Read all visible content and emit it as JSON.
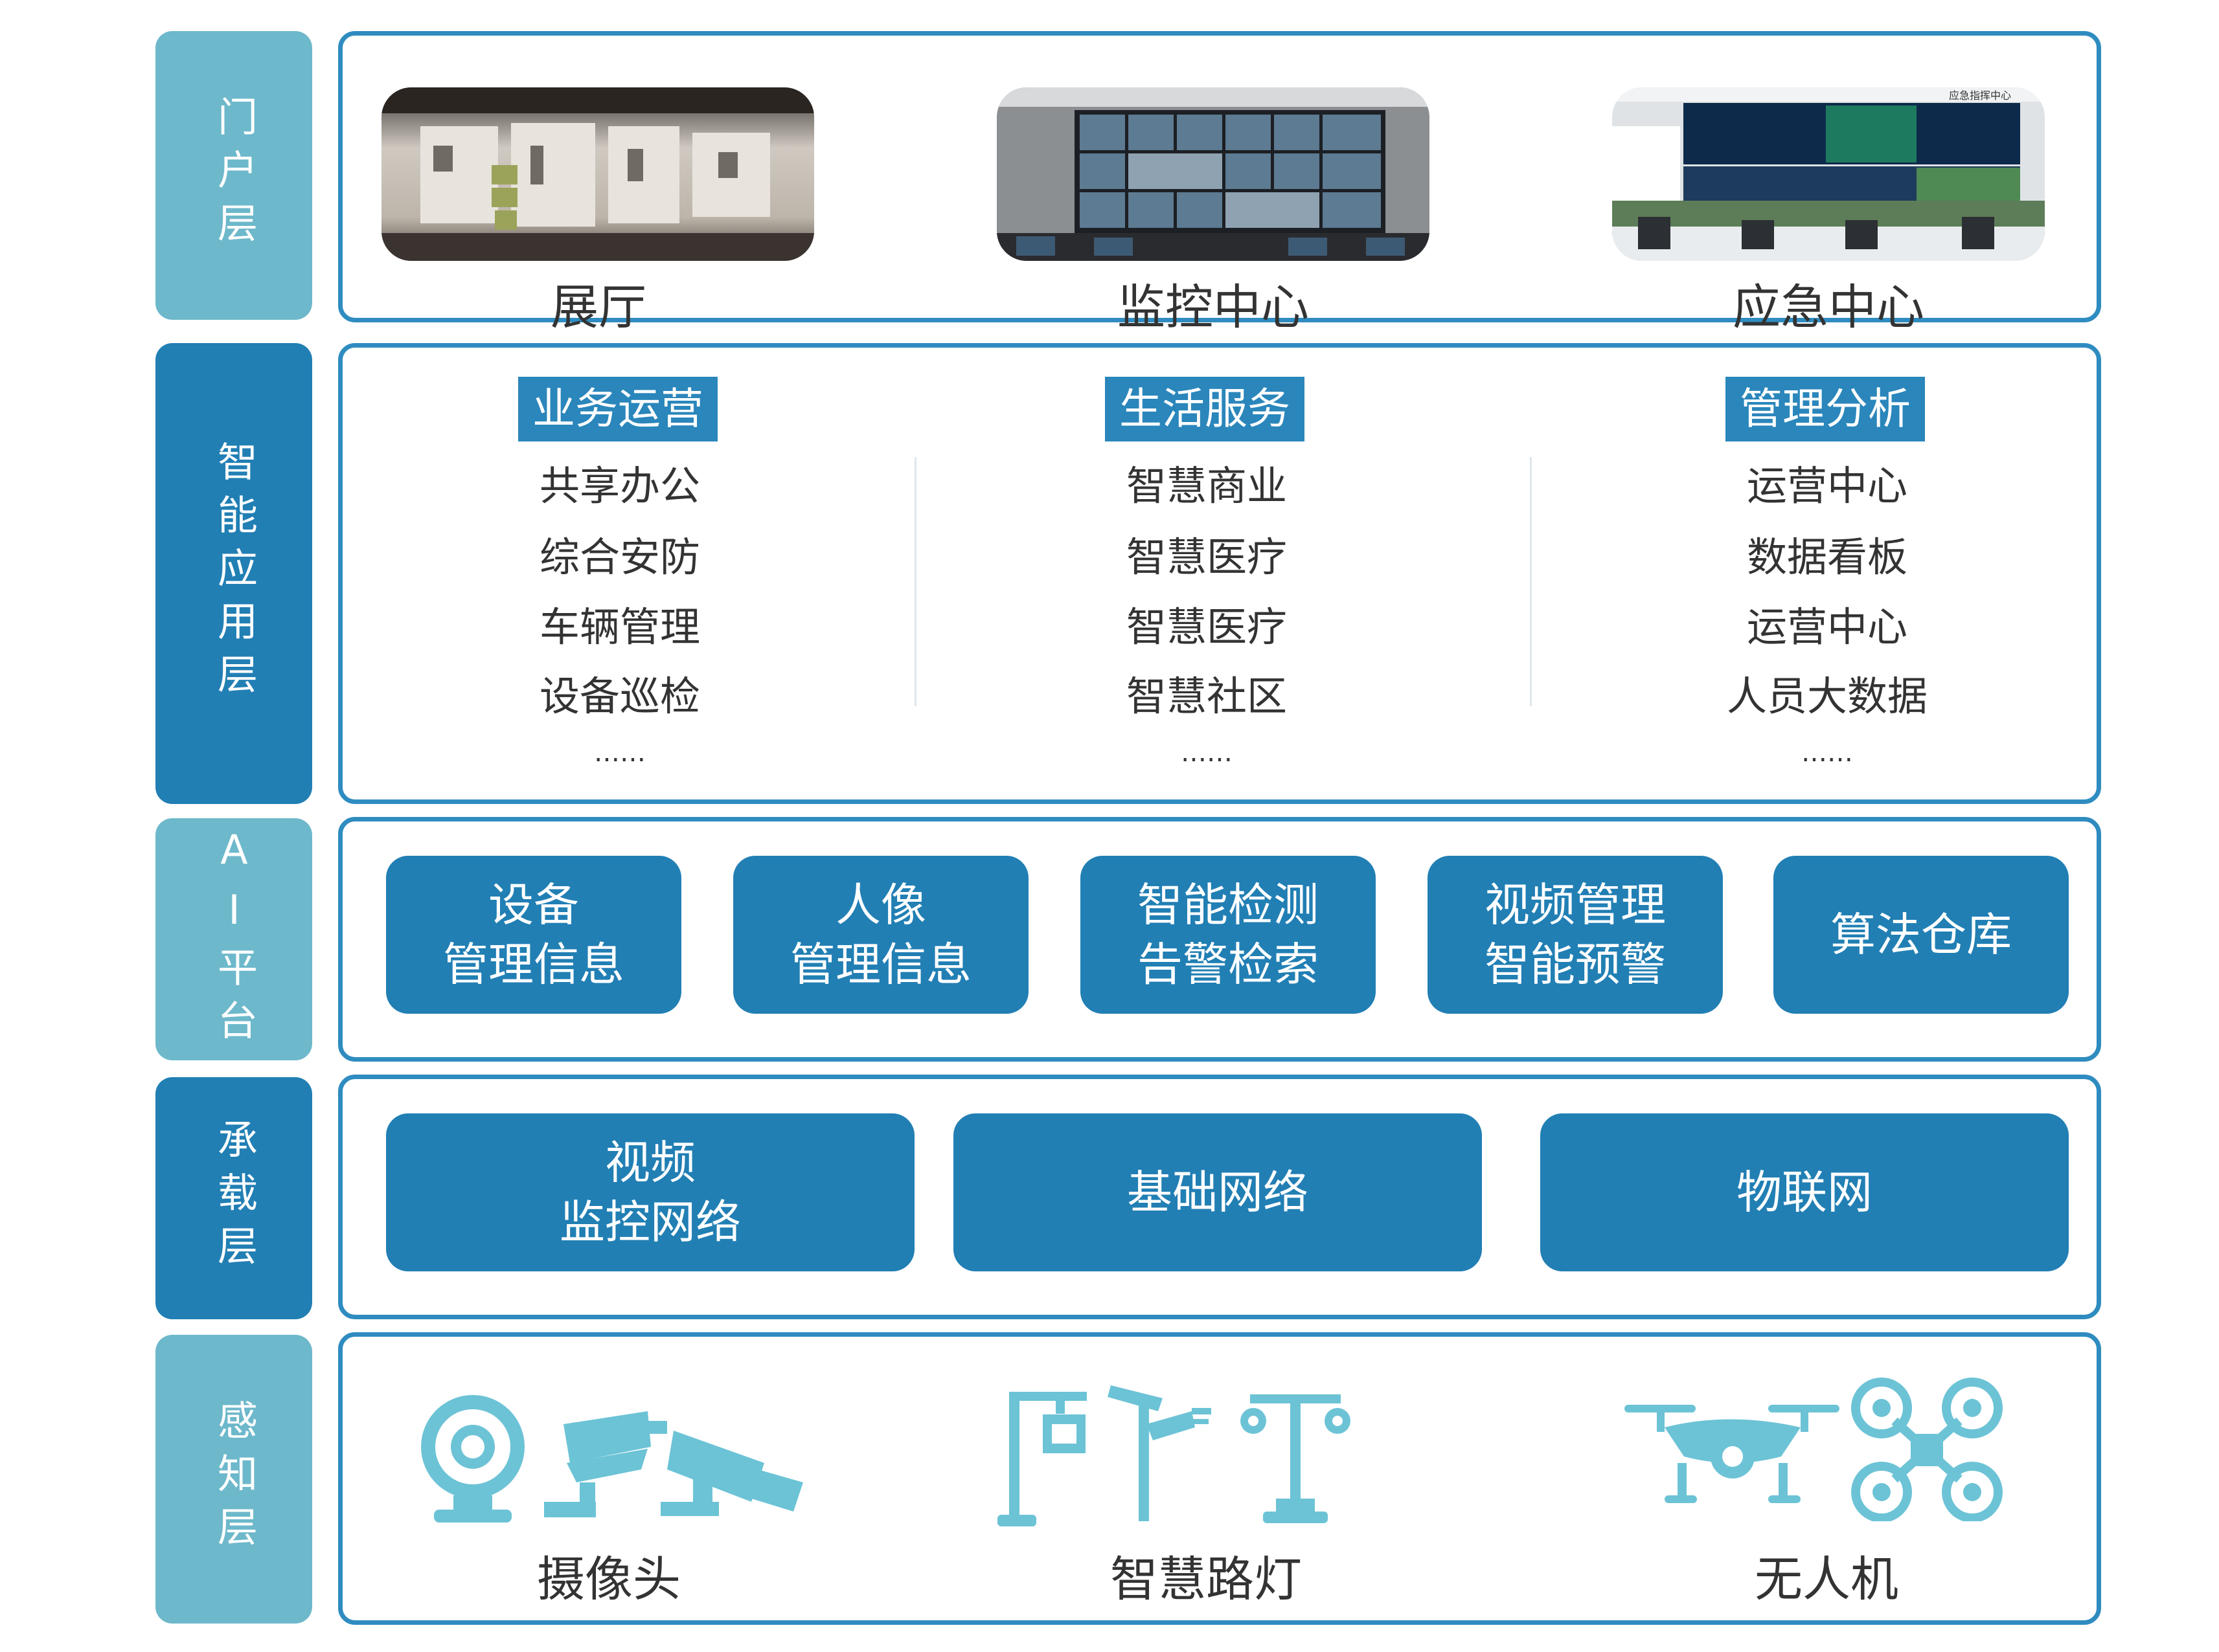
{
  "layers": {
    "portal": {
      "label": "门户层"
    },
    "app": {
      "label": "智能应用层"
    },
    "ai": {
      "label": "AI平台"
    },
    "carrier": {
      "label": "承载层"
    },
    "perception": {
      "label": "感知层"
    }
  },
  "portal": {
    "items": [
      {
        "label": "展厅"
      },
      {
        "label": "监控中心"
      },
      {
        "label": "应急中心"
      }
    ],
    "screen_text": "应急指挥中心"
  },
  "app": {
    "columns": [
      {
        "title": "业务运营",
        "items": [
          "共享办公",
          "综合安防",
          "车辆管理",
          "设备巡检"
        ],
        "more": "……"
      },
      {
        "title": "生活服务",
        "items": [
          "智慧商业",
          "智慧医疗",
          "智慧医疗",
          "智慧社区"
        ],
        "more": "……"
      },
      {
        "title": "管理分析",
        "items": [
          "运营中心",
          "数据看板",
          "运营中心",
          "人员大数据"
        ],
        "more": "……"
      }
    ]
  },
  "ai": {
    "boxes": [
      {
        "line1": "设备",
        "line2": "管理信息"
      },
      {
        "line1": "人像",
        "line2": "管理信息"
      },
      {
        "line1": "智能检测",
        "line2": "告警检索"
      },
      {
        "line1": "视频管理",
        "line2": "智能预警"
      },
      {
        "line1": "算法仓库",
        "line2": ""
      }
    ]
  },
  "carrier": {
    "boxes": [
      {
        "line1": "视频",
        "line2": "监控网络"
      },
      {
        "line1": "基础网络",
        "line2": ""
      },
      {
        "line1": "物联网",
        "line2": ""
      }
    ]
  },
  "perception": {
    "items": [
      {
        "label": "摄像头",
        "icon": "camera-icon"
      },
      {
        "label": "智慧路灯",
        "icon": "street-light-icon"
      },
      {
        "label": "无人机",
        "icon": "drone-icon"
      }
    ]
  },
  "colors": {
    "dark": "#217fb4",
    "light": "#6db8cb",
    "border": "#2f8cc0",
    "icon": "#6cc3d6"
  }
}
